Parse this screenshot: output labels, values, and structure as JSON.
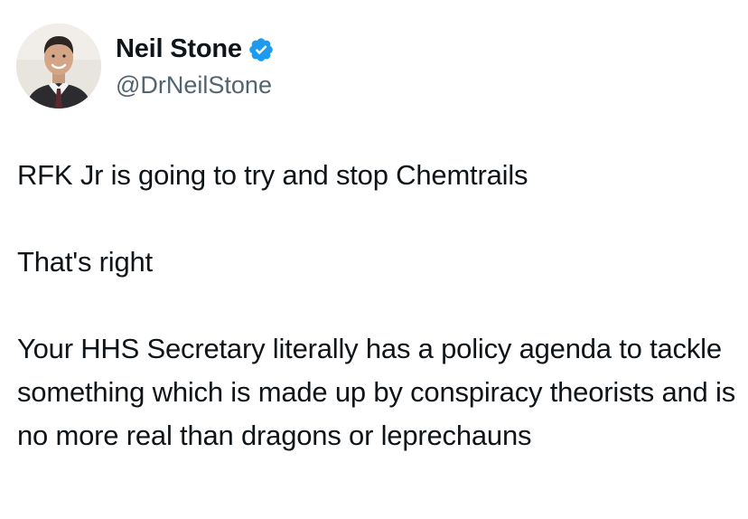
{
  "author": {
    "display_name": "Neil Stone",
    "handle": "@DrNeilStone",
    "verified_color": "#1d9bf0"
  },
  "tweet": {
    "paragraphs": [
      "RFK Jr is going to try and stop Chemtrails",
      "That's right",
      "Your HHS Secretary literally has a policy agenda to tackle something which is made up by conspiracy theorists and is no more real than dragons or leprechauns"
    ]
  }
}
